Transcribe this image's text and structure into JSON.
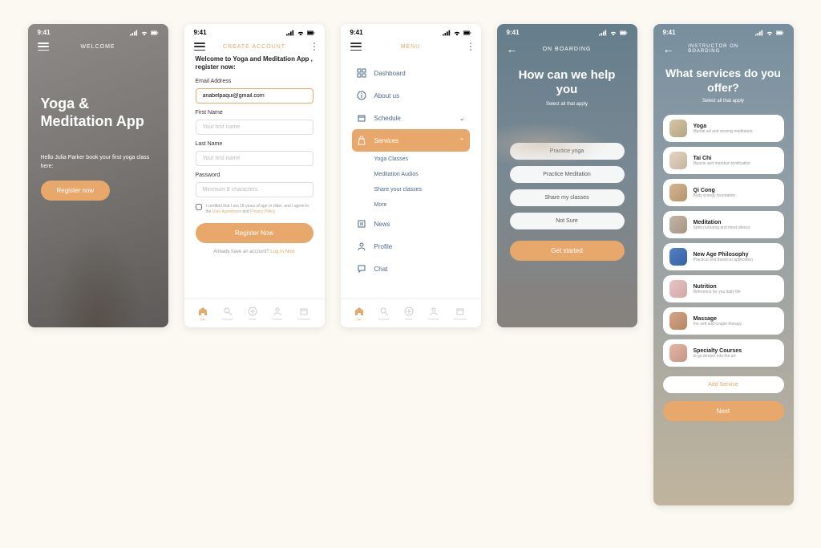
{
  "status_time": "9:41",
  "screen1": {
    "header": "WELCOME",
    "title": "Yoga & Meditation App",
    "subtitle": "Hello Julia Parker book your first yoga class here:",
    "cta": "Register now"
  },
  "screen2": {
    "header": "CREATE ACCOUNT",
    "welcome": "Welcome to Yoga and Meditation App , register now:",
    "fields": {
      "email_label": "Email Address",
      "email_value": "anabelpaqui@gmail.com",
      "first_label": "First Name",
      "first_placeholder": "Your first name",
      "last_label": "Last Name",
      "last_placeholder": "Your first name",
      "password_label": "Password",
      "password_placeholder": "Minimum 8 characters"
    },
    "consent_prefix": "I certified that I am 18 years of age or older, and I agree to the ",
    "consent_link1": "User Agreement",
    "consent_mid": " and ",
    "consent_link2": "Privacy Policy",
    "cta": "Register Now",
    "login_text": "Already have an account? ",
    "login_link": "Log In Now",
    "nav": [
      "QA",
      "Explore",
      "Book",
      "Friends",
      "Schedule"
    ]
  },
  "screen3": {
    "header": "MENU",
    "items": {
      "dashboard": "Dashboard",
      "about": "About us",
      "schedule": "Schedule",
      "services": "Services",
      "news": "News",
      "profile": "Profile",
      "chat": "Chat"
    },
    "submenu": [
      "Yoga Classes",
      "Meditation Audios",
      "Share your classes",
      "More"
    ]
  },
  "screen4": {
    "header": "ON BOARDING",
    "title": "How can we help you",
    "subtitle": "Select all that apply",
    "options": [
      "Practice yoga",
      "Practice Meditation",
      "Share my classes",
      "Not Sure"
    ],
    "cta": "Get started"
  },
  "screen5": {
    "header": "INSTRUCTOR ON BOARDING",
    "title": "What services do you  offer?",
    "subtitle": "Select all that apply",
    "services": [
      {
        "name": "Yoga",
        "desc": "Martial art and moving meditation"
      },
      {
        "name": "Tai Chi",
        "desc": "Muscle and meridian tonification"
      },
      {
        "name": "Qi Cong",
        "desc": "Body energy foundation"
      },
      {
        "name": "Meditation",
        "desc": "Spirit nurturing and mind silence"
      },
      {
        "name": "New Age Philosophy",
        "desc": "Practical and theorical application"
      },
      {
        "name": "Nutrition",
        "desc": "Reference for you daily life"
      },
      {
        "name": "Massage",
        "desc": "For self and couple therapy"
      },
      {
        "name": "Specialty Courses",
        "desc": "to go deeper into the art"
      }
    ],
    "add_btn": "Add Service",
    "next_btn": "Next"
  }
}
